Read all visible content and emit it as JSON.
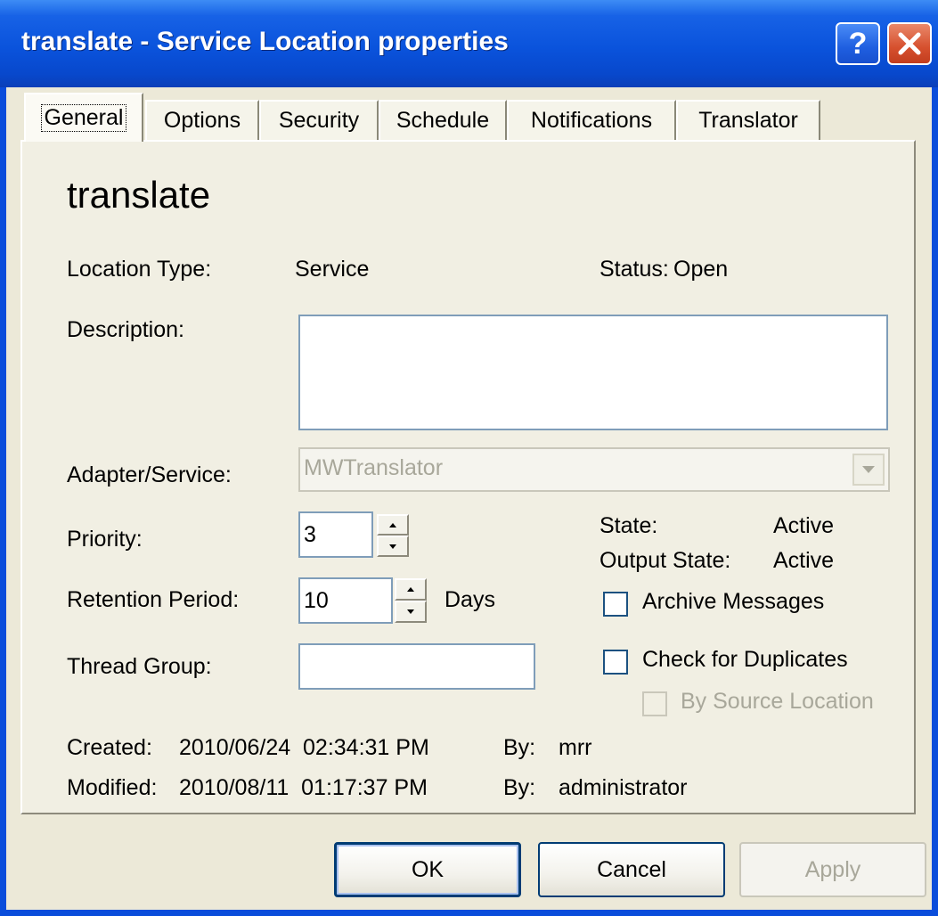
{
  "window": {
    "title": "translate - Service Location properties",
    "help_symbol": "?",
    "close_symbol": "✕"
  },
  "tabs": [
    {
      "label": "General",
      "active": true
    },
    {
      "label": "Options",
      "active": false
    },
    {
      "label": "Security",
      "active": false
    },
    {
      "label": "Schedule",
      "active": false
    },
    {
      "label": "Notifications",
      "active": false
    },
    {
      "label": "Translator",
      "active": false
    }
  ],
  "general": {
    "heading": "translate",
    "location_type_label": "Location Type:",
    "location_type_value": "Service",
    "status_label": "Status:",
    "status_value": "Open",
    "description_label": "Description:",
    "description_value": "",
    "adapter_label": "Adapter/Service:",
    "adapter_value": "MWTranslator",
    "priority_label": "Priority:",
    "priority_value": "3",
    "retention_label": "Retention Period:",
    "retention_value": "10",
    "retention_unit": "Days",
    "thread_group_label": "Thread Group:",
    "thread_group_value": "",
    "state_label": "State:",
    "state_value": "Active",
    "output_state_label": "Output State:",
    "output_state_value": "Active",
    "archive_label": "Archive Messages",
    "archive_checked": false,
    "duplicates_label": "Check for Duplicates",
    "duplicates_checked": false,
    "by_source_label": "By Source Location",
    "by_source_checked": false,
    "created_label": "Created:",
    "created_value": "2010/06/24  02:34:31 PM",
    "created_by_label": "By:",
    "created_by_value": "mrr",
    "modified_label": "Modified:",
    "modified_value": "2010/08/11  01:17:37 PM",
    "modified_by_label": "By:",
    "modified_by_value": "administrator"
  },
  "buttons": {
    "ok": "OK",
    "cancel": "Cancel",
    "apply": "Apply"
  },
  "colors": {
    "titlebar": "#0a53dc",
    "dialog_bg": "#ece9d8",
    "close_button": "#d6502e"
  }
}
